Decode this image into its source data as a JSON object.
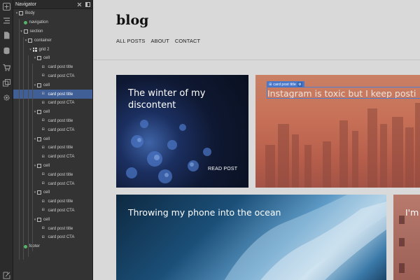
{
  "rail": {
    "icons": [
      "add-icon",
      "menu-icon",
      "pages-icon",
      "database-icon",
      "cart-icon",
      "assets-icon",
      "settings-icon",
      "exit-icon"
    ]
  },
  "navigator": {
    "title": "Navigator",
    "tree": [
      {
        "label": "Body",
        "type": "box",
        "depth": 0,
        "caret": "▾"
      },
      {
        "label": "navigation",
        "type": "component",
        "depth": 1,
        "caret": ""
      },
      {
        "label": "section",
        "type": "box",
        "depth": 1,
        "caret": "▾"
      },
      {
        "label": "container",
        "type": "box",
        "depth": 2,
        "caret": "▾"
      },
      {
        "label": "grid 2",
        "type": "grid",
        "depth": 3,
        "caret": "▾"
      },
      {
        "label": "cell",
        "type": "box",
        "depth": 4,
        "caret": "▾"
      },
      {
        "label": "card post title",
        "type": "tag",
        "depth": 5,
        "caret": ""
      },
      {
        "label": "card post CTA",
        "type": "tag",
        "depth": 5,
        "caret": ""
      },
      {
        "label": "cell",
        "type": "box",
        "depth": 4,
        "caret": "▾"
      },
      {
        "label": "card post title",
        "type": "tag",
        "depth": 5,
        "caret": "",
        "selected": true
      },
      {
        "label": "card post CTA",
        "type": "tag",
        "depth": 5,
        "caret": ""
      },
      {
        "label": "cell",
        "type": "box",
        "depth": 4,
        "caret": "▾"
      },
      {
        "label": "card post title",
        "type": "tag",
        "depth": 5,
        "caret": ""
      },
      {
        "label": "card post CTA",
        "type": "tag",
        "depth": 5,
        "caret": ""
      },
      {
        "label": "cell",
        "type": "box",
        "depth": 4,
        "caret": "▾"
      },
      {
        "label": "card post title",
        "type": "tag",
        "depth": 5,
        "caret": ""
      },
      {
        "label": "card post CTA",
        "type": "tag",
        "depth": 5,
        "caret": ""
      },
      {
        "label": "cell",
        "type": "box",
        "depth": 4,
        "caret": "▾"
      },
      {
        "label": "card post title",
        "type": "tag",
        "depth": 5,
        "caret": ""
      },
      {
        "label": "card post CTA",
        "type": "tag",
        "depth": 5,
        "caret": ""
      },
      {
        "label": "cell",
        "type": "box",
        "depth": 4,
        "caret": "▾"
      },
      {
        "label": "card post title",
        "type": "tag",
        "depth": 5,
        "caret": ""
      },
      {
        "label": "card post CTA",
        "type": "tag",
        "depth": 5,
        "caret": ""
      },
      {
        "label": "cell",
        "type": "box",
        "depth": 4,
        "caret": "▾"
      },
      {
        "label": "card post title",
        "type": "tag",
        "depth": 5,
        "caret": ""
      },
      {
        "label": "card post CTA",
        "type": "tag",
        "depth": 5,
        "caret": ""
      },
      {
        "label": "footer",
        "type": "component",
        "depth": 1,
        "caret": ""
      }
    ]
  },
  "page": {
    "brand": "blog",
    "nav_links": [
      "ALL POSTS",
      "ABOUT",
      "CONTACT"
    ],
    "cards": [
      {
        "title": "The winter of my discontent",
        "cta": "READ POST"
      },
      {
        "title": "Instagram is toxic but I keep posti"
      },
      {
        "title": "Throwing my phone into the ocean"
      },
      {
        "title": "I'm roc"
      }
    ],
    "selection_label": "card post title",
    "colors": {
      "selection": "#4a78c9",
      "tree_selected": "#3f5f96"
    }
  }
}
